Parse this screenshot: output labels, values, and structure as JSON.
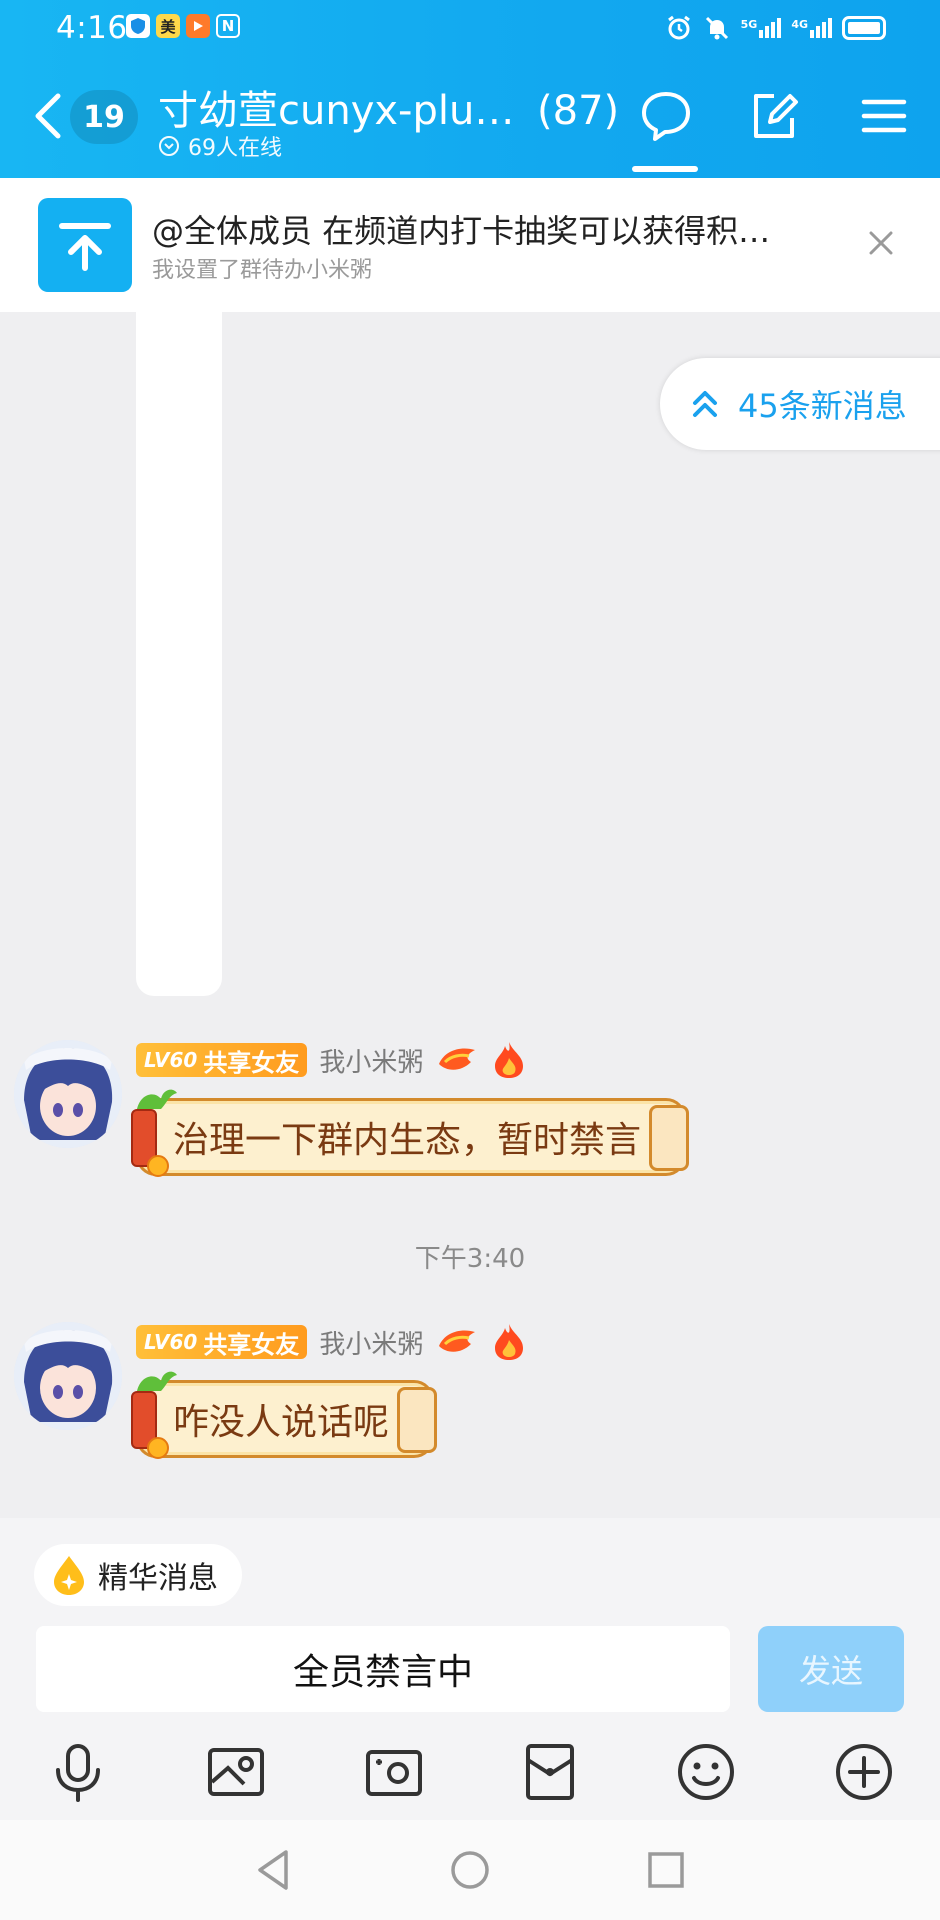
{
  "status_bar": {
    "time": "4:16",
    "left_icons": [
      "shield-icon",
      "美",
      "play-icon",
      "N"
    ],
    "network_a": "5G",
    "network_b": "4G"
  },
  "header": {
    "unread_count": "19",
    "group_title": "寸幼萱cunyx-plu…",
    "member_count": "(87)",
    "online_text": "69人在线"
  },
  "pinned": {
    "title": "@全体成员  在频道内打卡抽奖可以获得积…",
    "subtitle": "我设置了群待办小米粥"
  },
  "new_messages": "45条新消息",
  "messages": [
    {
      "level": "LV60",
      "title": "共享女友",
      "name": "我小米粥",
      "text": "治理一下群内生态，暂时禁言"
    },
    {
      "level": "LV60",
      "title": "共享女友",
      "name": "我小米粥",
      "text": "咋没人说话呢"
    }
  ],
  "timestamp": "下午3:40",
  "composer": {
    "essence_label": "精华消息",
    "input_text": "全员禁言中",
    "send_label": "发送"
  },
  "toolbar_icons": [
    "microphone-icon",
    "image-icon",
    "camera-icon",
    "red-packet-icon",
    "emoji-icon",
    "plus-icon"
  ],
  "nav_icons": [
    "back-triangle-icon",
    "home-circle-icon",
    "recents-square-icon"
  ],
  "colors": {
    "header_blue": "#14ACF0",
    "accent_blue": "#1AA1EE",
    "send_disabled": "#8FD0FA"
  }
}
